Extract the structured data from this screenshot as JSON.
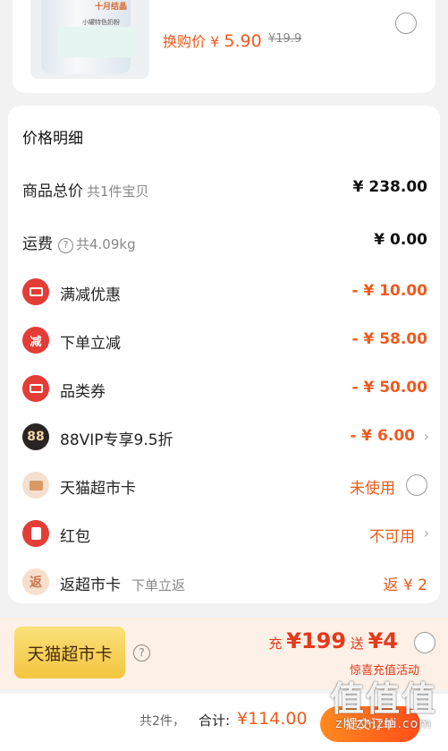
{
  "product": {
    "swap_label": "换购价",
    "currency": "¥",
    "price": "5.90",
    "orig_price": "¥19.9",
    "image_label": "小罐特色奶粉",
    "image_brand": "十月结晶"
  },
  "detail": {
    "title": "价格明细",
    "rows": [
      {
        "label": "商品总价",
        "sub": "共1件宝贝",
        "value": "¥ 238.00"
      },
      {
        "label": "运费",
        "sub": "共4.09kg",
        "value": "¥ 0.00"
      },
      {
        "label": "满减优惠",
        "value": "- ¥ 10.00",
        "icon": "ticket-icon"
      },
      {
        "label": "下单立减",
        "value": "- ¥ 58.00",
        "icon": "discount-icon",
        "icon_text": "减"
      },
      {
        "label": "品类券",
        "value": "- ¥ 50.00",
        "icon": "ticket-icon"
      },
      {
        "label": "88VIP专享9.5折",
        "value": "- ¥ 6.00",
        "icon": "vip88-icon",
        "icon_text": "88"
      },
      {
        "label": "天猫超市卡",
        "value": "未使用",
        "icon": "card-icon"
      },
      {
        "label": "红包",
        "value": "不可用",
        "icon": "red-packet-icon"
      },
      {
        "label": "返超市卡",
        "sub": "下单立返",
        "value": "返 ¥ 2",
        "icon": "rebate-icon",
        "icon_text": "返"
      }
    ]
  },
  "promo": {
    "badge": "天猫超市卡",
    "charge_label": "充",
    "charge_value": "¥199",
    "gift_label": "送",
    "gift_value": "¥4",
    "subtitle": "惊喜充值活动"
  },
  "footer": {
    "count": "共2件，",
    "total_label": "合计:",
    "total_value": "¥114.00",
    "submit": "提交订单"
  },
  "watermark": {
    "big": "值值值",
    "small": "zhizhizhi.com"
  },
  "colors": {
    "accent": "#f05a1e",
    "discount": "#f05a1e",
    "promo_red": "#e4391b",
    "badge_gold": "#f3c540"
  }
}
